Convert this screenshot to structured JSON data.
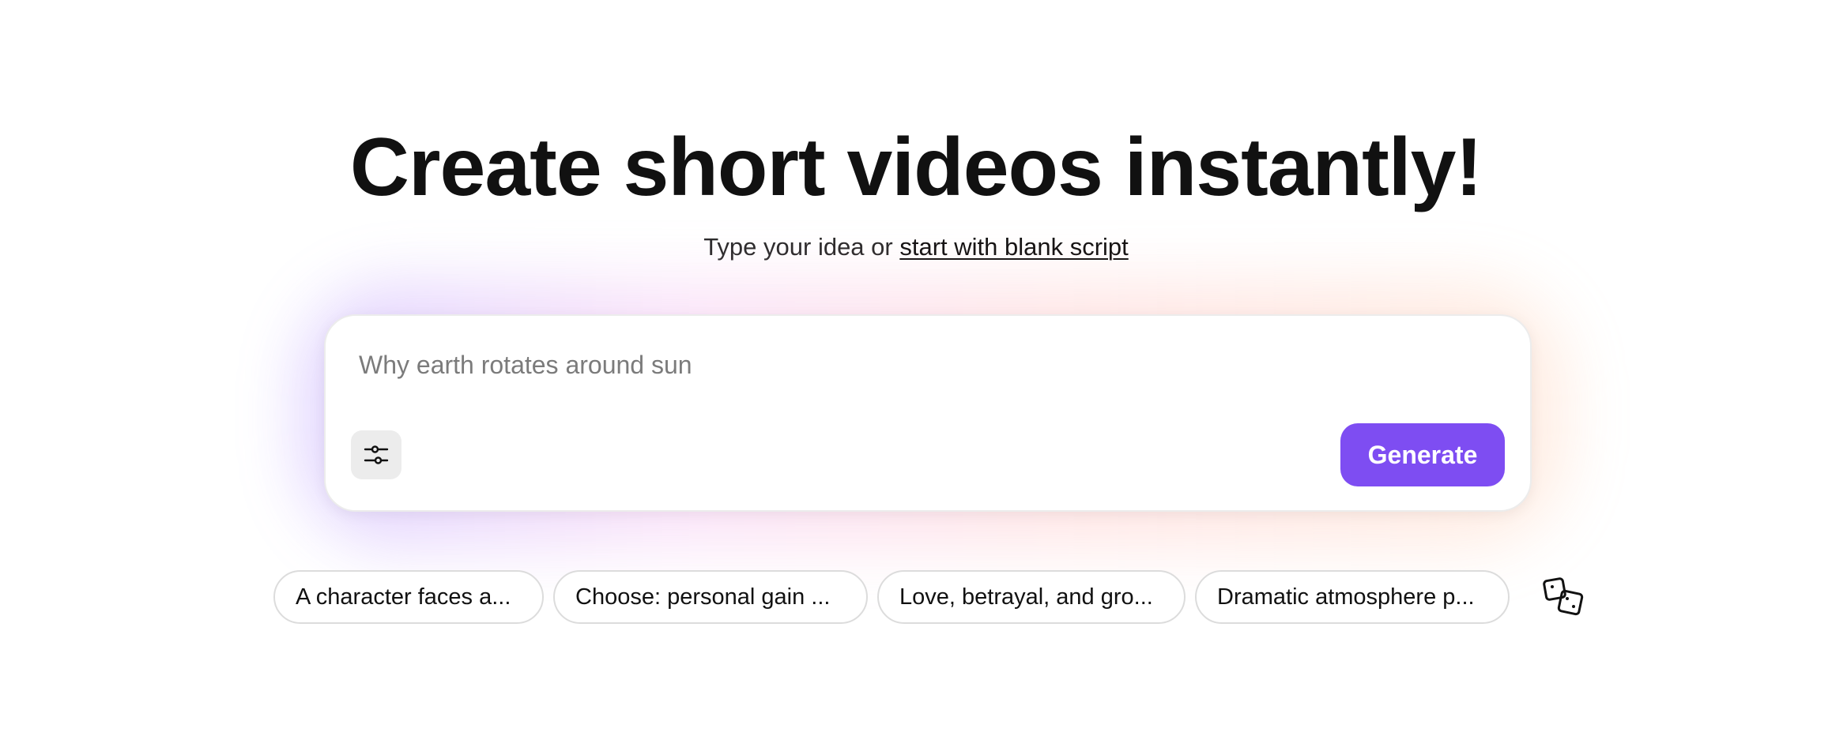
{
  "hero": {
    "title": "Create short videos instantly!",
    "subtitle_prefix": "Type your idea or ",
    "subtitle_link": "start with blank script"
  },
  "prompt": {
    "placeholder": "Why earth rotates around sun",
    "value": "",
    "settings_icon": "sliders-icon",
    "generate_label": "Generate"
  },
  "suggestions": [
    {
      "label": "A character faces a..."
    },
    {
      "label": "Choose: personal gain ..."
    },
    {
      "label": "Love, betrayal, and gro..."
    },
    {
      "label": "Dramatic atmosphere p..."
    }
  ],
  "shuffle_icon": "dice-icon",
  "colors": {
    "accent": "#7e4df2",
    "text": "#111111",
    "muted": "#7b7b7b"
  }
}
